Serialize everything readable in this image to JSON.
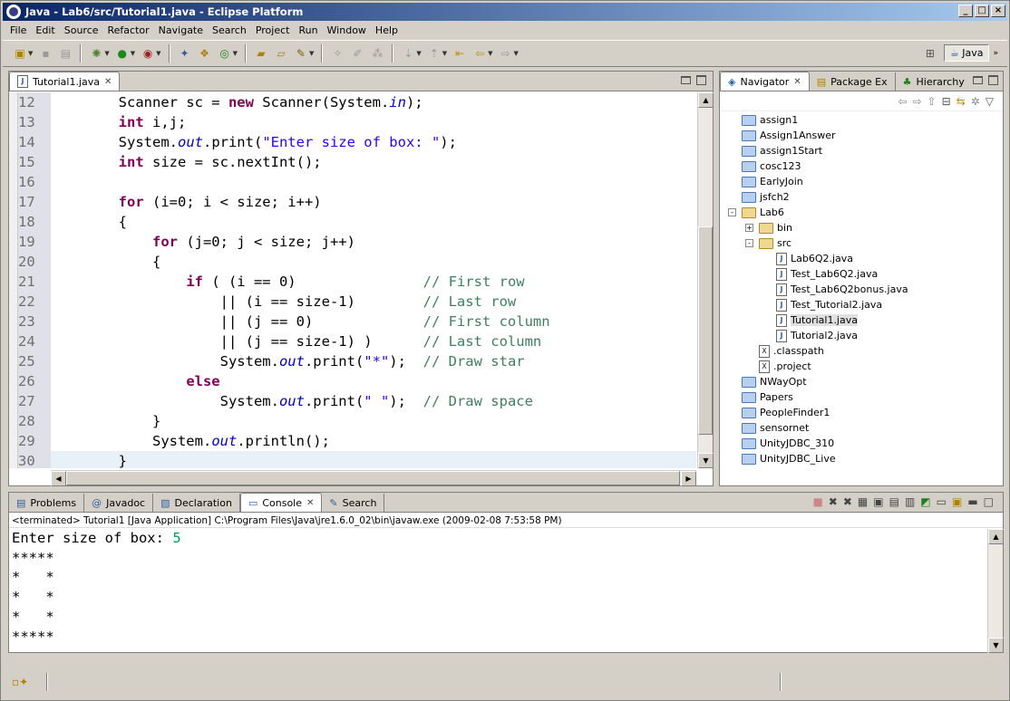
{
  "window": {
    "title": "Java - Lab6/src/Tutorial1.java - Eclipse Platform"
  },
  "menu": [
    "File",
    "Edit",
    "Source",
    "Refactor",
    "Navigate",
    "Search",
    "Project",
    "Run",
    "Window",
    "Help"
  ],
  "perspective": {
    "label": "Java"
  },
  "editor": {
    "tab_label": "Tutorial1.java",
    "lines": [
      {
        "n": "12",
        "code": [
          [
            "",
            "        Scanner sc = "
          ],
          [
            "kw",
            "new"
          ],
          [
            "",
            " Scanner(System."
          ],
          [
            "fld",
            "in"
          ],
          [
            "",
            ");"
          ]
        ]
      },
      {
        "n": "13",
        "code": [
          [
            "",
            "        "
          ],
          [
            "kw",
            "int"
          ],
          [
            "",
            " i,j;"
          ]
        ]
      },
      {
        "n": "14",
        "code": [
          [
            "",
            "        System."
          ],
          [
            "fld",
            "out"
          ],
          [
            "",
            ".print("
          ],
          [
            "str",
            "\"Enter size of box: \""
          ],
          [
            "",
            ");"
          ]
        ]
      },
      {
        "n": "15",
        "code": [
          [
            "",
            "        "
          ],
          [
            "kw",
            "int"
          ],
          [
            "",
            " size = sc.nextInt();"
          ]
        ]
      },
      {
        "n": "16",
        "code": [
          [
            "",
            ""
          ]
        ]
      },
      {
        "n": "17",
        "code": [
          [
            "",
            "        "
          ],
          [
            "kw",
            "for"
          ],
          [
            "",
            " (i=0; i < size; i++)"
          ]
        ]
      },
      {
        "n": "18",
        "code": [
          [
            "",
            "        {"
          ]
        ]
      },
      {
        "n": "19",
        "code": [
          [
            "",
            "            "
          ],
          [
            "kw",
            "for"
          ],
          [
            "",
            " (j=0; j < size; j++)"
          ]
        ]
      },
      {
        "n": "20",
        "code": [
          [
            "",
            "            {"
          ]
        ]
      },
      {
        "n": "21",
        "code": [
          [
            "",
            "                "
          ],
          [
            "kw",
            "if"
          ],
          [
            "",
            " ( (i == 0)               "
          ],
          [
            "cm",
            "// First row"
          ]
        ]
      },
      {
        "n": "22",
        "code": [
          [
            "",
            "                    || (i == size-1)        "
          ],
          [
            "cm",
            "// Last row"
          ]
        ]
      },
      {
        "n": "23",
        "code": [
          [
            "",
            "                    || (j == 0)             "
          ],
          [
            "cm",
            "// First column"
          ]
        ]
      },
      {
        "n": "24",
        "code": [
          [
            "",
            "                    || (j == size-1) )      "
          ],
          [
            "cm",
            "// Last column"
          ]
        ]
      },
      {
        "n": "25",
        "code": [
          [
            "",
            "                    System."
          ],
          [
            "fld",
            "out"
          ],
          [
            "",
            ".print("
          ],
          [
            "str",
            "\"*\""
          ],
          [
            "",
            ");  "
          ],
          [
            "cm",
            "// Draw star"
          ]
        ]
      },
      {
        "n": "26",
        "code": [
          [
            "",
            "                "
          ],
          [
            "kw",
            "else"
          ]
        ]
      },
      {
        "n": "27",
        "code": [
          [
            "",
            "                    System."
          ],
          [
            "fld",
            "out"
          ],
          [
            "",
            ".print("
          ],
          [
            "str",
            "\" \""
          ],
          [
            "",
            ");  "
          ],
          [
            "cm",
            "// Draw space"
          ]
        ]
      },
      {
        "n": "28",
        "code": [
          [
            "",
            "            }"
          ]
        ]
      },
      {
        "n": "29",
        "code": [
          [
            "",
            "            System."
          ],
          [
            "fld",
            "out"
          ],
          [
            "",
            ".println();"
          ]
        ]
      },
      {
        "n": "30",
        "code": [
          [
            "",
            "        }"
          ]
        ]
      }
    ]
  },
  "navigator": {
    "tabs": [
      "Navigator",
      "Package Ex",
      "Hierarchy"
    ],
    "items": [
      {
        "label": "assign1",
        "type": "project",
        "depth": 0
      },
      {
        "label": "Assign1Answer",
        "type": "project",
        "depth": 0
      },
      {
        "label": "assign1Start",
        "type": "project",
        "depth": 0
      },
      {
        "label": "cosc123",
        "type": "project",
        "depth": 0
      },
      {
        "label": "EarlyJoin",
        "type": "project",
        "depth": 0
      },
      {
        "label": "jsfch2",
        "type": "project",
        "depth": 0
      },
      {
        "label": "Lab6",
        "type": "project-open",
        "depth": 0,
        "exp": "-"
      },
      {
        "label": "bin",
        "type": "folder",
        "depth": 1,
        "exp": "+"
      },
      {
        "label": "src",
        "type": "folder-open",
        "depth": 1,
        "exp": "-"
      },
      {
        "label": "Lab6Q2.java",
        "type": "java",
        "depth": 2
      },
      {
        "label": "Test_Lab6Q2.java",
        "type": "java",
        "depth": 2
      },
      {
        "label": "Test_Lab6Q2bonus.java",
        "type": "java",
        "depth": 2
      },
      {
        "label": "Test_Tutorial2.java",
        "type": "java",
        "depth": 2
      },
      {
        "label": "Tutorial1.java",
        "type": "java",
        "depth": 2,
        "selected": true
      },
      {
        "label": "Tutorial2.java",
        "type": "java",
        "depth": 2
      },
      {
        "label": ".classpath",
        "type": "xfile",
        "depth": 1
      },
      {
        "label": ".project",
        "type": "xfile",
        "depth": 1
      },
      {
        "label": "NWayOpt",
        "type": "project",
        "depth": 0
      },
      {
        "label": "Papers",
        "type": "project",
        "depth": 0
      },
      {
        "label": "PeopleFinder1",
        "type": "project",
        "depth": 0
      },
      {
        "label": "sensornet",
        "type": "project",
        "depth": 0
      },
      {
        "label": "UnityJDBC_310",
        "type": "project",
        "depth": 0
      },
      {
        "label": "UnityJDBC_Live",
        "type": "project",
        "depth": 0
      }
    ]
  },
  "bottom": {
    "tabs": [
      {
        "label": "Problems",
        "icon": "problems-icon"
      },
      {
        "label": "Javadoc",
        "icon": "at-icon"
      },
      {
        "label": "Declaration",
        "icon": "declaration-icon"
      },
      {
        "label": "Console",
        "icon": "console-icon",
        "active": true
      },
      {
        "label": "Search",
        "icon": "search-icon"
      }
    ],
    "console_header": "<terminated> Tutorial1 [Java Application] C:\\Program Files\\Java\\jre1.6.0_02\\bin\\javaw.exe (2009-02-08 7:53:58 PM)",
    "prompt": "Enter size of box: ",
    "input": "5",
    "output": [
      "*****",
      "*   *",
      "*   *",
      "*   *",
      "*****"
    ]
  },
  "colors": {
    "keyword": "#7f0055",
    "string": "#2a00ff",
    "comment": "#3f7f5f",
    "field": "#0000c0",
    "title_start": "#0a246a",
    "title_end": "#a6caf0"
  }
}
